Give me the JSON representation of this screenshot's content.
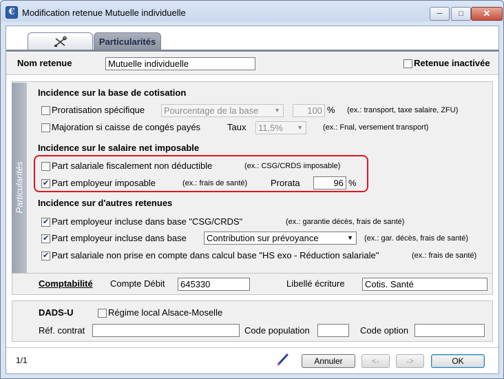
{
  "window": {
    "title": "Modification retenue Mutuelle individuelle",
    "app_icon": "€"
  },
  "tabs": [
    {
      "name": "general",
      "icon": "tools-icon"
    },
    {
      "name": "particularites",
      "label": "Particularités"
    }
  ],
  "header": {
    "nom_label": "Nom retenue",
    "nom_value": "Mutuelle individuelle",
    "inactive_label": "Retenue inactivée",
    "inactive_checked": false
  },
  "sidebar_label": "Particularités",
  "base_cotisation": {
    "title": "Incidence sur la base de cotisation",
    "proratisation": {
      "label": "Proratisation spécifique",
      "checked": false,
      "select": "Pourcentage de la base",
      "value": "100",
      "unit": "%",
      "hint": "(ex.: transport, taxe salaire, ZFU)"
    },
    "majoration": {
      "label": "Majoration si caisse de congés payés",
      "checked": false,
      "taux_label": "Taux",
      "taux_value": "11,5%",
      "hint": "(ex.: Fnal, versement transport)"
    }
  },
  "salaire_net": {
    "title": "Incidence sur le salaire net imposable",
    "part_salariale": {
      "label": "Part salariale fiscalement non déductible",
      "checked": false,
      "hint": "(ex.: CSG/CRDS imposable)"
    },
    "part_employeur": {
      "label": "Part employeur imposable",
      "checked": true,
      "hint": "(ex.: frais de santé)",
      "prorata_label": "Prorata",
      "prorata_value": "96",
      "unit": "%"
    }
  },
  "autres_retenues": {
    "title": "Incidence sur d'autres retenues",
    "items": [
      {
        "label": "Part employeur incluse dans base \"CSG/CRDS\"",
        "checked": true,
        "hint": "(ex.: garantie décès, frais de santé)"
      },
      {
        "label": "Part employeur incluse dans base",
        "checked": true,
        "select": "Contribution sur prévoyance",
        "hint": "(ex.: gar. décès, frais de santé)"
      },
      {
        "label": "Part salariale non prise en compte dans calcul base \"HS exo - Réduction salariale\"",
        "checked": true,
        "hint": "(ex.: frais de santé)"
      }
    ]
  },
  "comptabilite": {
    "title": "Comptabilité",
    "compte_label": "Compte Débit",
    "compte_value": "645330",
    "libelle_label": "Libellé écriture",
    "libelle_value": "Cotis. Santé"
  },
  "dads": {
    "title": "DADS-U",
    "regime_label": "Régime local Alsace-Moselle",
    "regime_checked": false,
    "ref_label": "Réf. contrat",
    "ref_value": "",
    "code_pop_label": "Code population",
    "code_pop_value": "",
    "code_option_label": "Code option",
    "code_option_value": ""
  },
  "footer": {
    "page": "1/1",
    "cancel": "Annuler",
    "prev": "<-",
    "next": "->",
    "ok": "OK"
  },
  "colors": {
    "highlight": "#e0151c",
    "tab_active": "#8b93a1"
  }
}
